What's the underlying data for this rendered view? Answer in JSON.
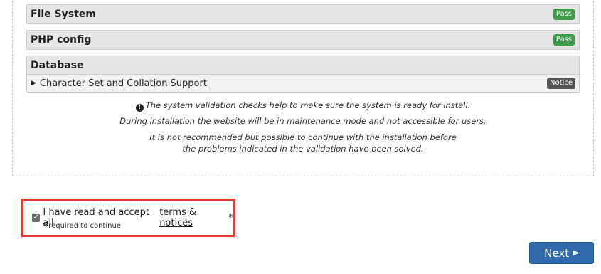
{
  "sections": {
    "file_system": {
      "title": "File System",
      "badge": "Pass"
    },
    "php_config": {
      "title": "PHP config",
      "badge": "Pass"
    },
    "database": {
      "title": "Database",
      "items": [
        {
          "label": "Character Set and Collation Support",
          "badge": "Notice"
        }
      ]
    }
  },
  "info": {
    "line1": "The system validation checks help to make sure the system is ready for install.",
    "line2": "During installation the website will be in maintenance mode and not accessible for users.",
    "line3": "It is not recommended but possible to continue with the installation before",
    "line4": "the problems indicated in the validation have been solved."
  },
  "terms": {
    "checked": true,
    "text": "I have read and accept all",
    "link": "terms & notices",
    "asterisk": "*",
    "required_note": "* required to continue"
  },
  "next_button": {
    "label": "Next"
  },
  "colors": {
    "pass": "#3f9b4a",
    "notice": "#555555",
    "primary": "#2f6bab",
    "highlight": "#e53935"
  }
}
